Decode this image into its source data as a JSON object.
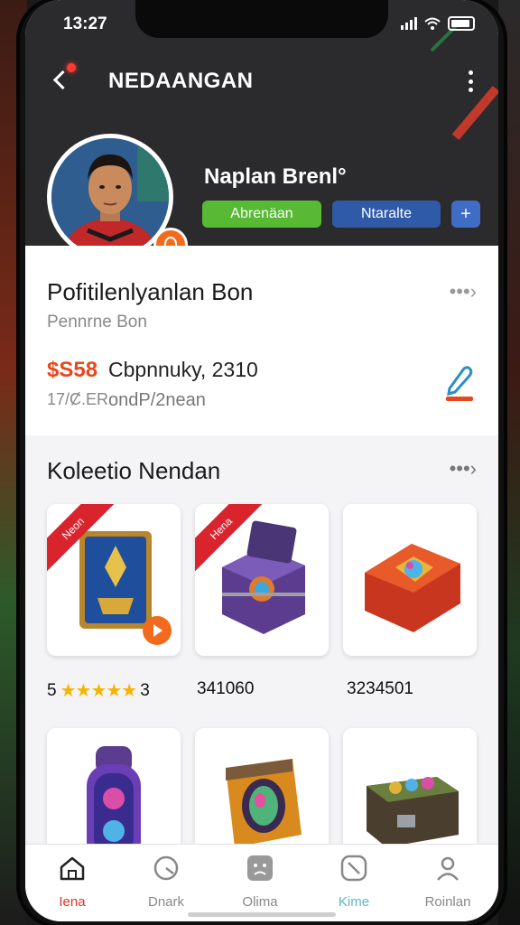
{
  "status_bar": {
    "time": "13:27"
  },
  "header": {
    "title": "NEDAANGAN",
    "player_name": "Naplan Brenl°",
    "primary_button": "Abrenäan",
    "secondary_button": "Ntaralte",
    "plus_button": "+"
  },
  "profile_card": {
    "title": "Pofitilenlyanlan Bon",
    "subtitle": "Pennrne Bon",
    "price": "$S58",
    "count_label": "Cbpnnuky, 2310",
    "small_left": "17/Ȼ.ER",
    "small_right": "ondP/2nean",
    "arrow": "•••›"
  },
  "collection": {
    "title": "Koleetio Nendan",
    "more": "•••›",
    "ribbon_text": "Neon",
    "ribbon_text_2": "Hena",
    "rating_prefix": "5",
    "stars": "★★★★★",
    "rating_suffix": "3",
    "value_2": "341060",
    "value_3": "3234501"
  },
  "tabs": [
    {
      "label": "Iena",
      "icon": "home-icon",
      "active": true
    },
    {
      "label": "Dnark",
      "icon": "clock-icon",
      "active": false
    },
    {
      "label": "Olima",
      "icon": "face-icon",
      "active": false
    },
    {
      "label": "Kime",
      "icon": "compass-icon",
      "active": false
    },
    {
      "label": "Roinlan",
      "icon": "user-icon",
      "active": false
    }
  ],
  "colors": {
    "accent_green": "#57b934",
    "accent_blue": "#2f5aa8",
    "accent_orange": "#f26b1d",
    "ribbon_red": "#d9232d",
    "active_tab": "#e0322a",
    "teal_tab": "#5bb8c9"
  }
}
